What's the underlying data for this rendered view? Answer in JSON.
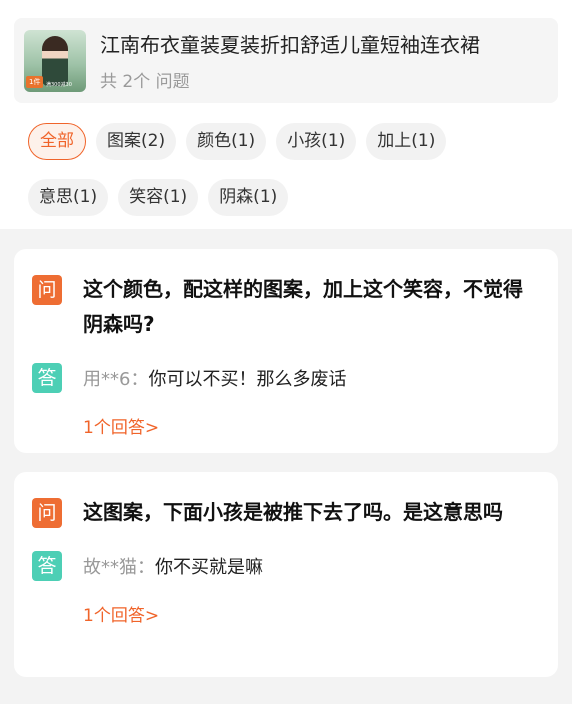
{
  "product": {
    "title": "江南布衣童装夏装折扣舒适儿童短袖连衣裙",
    "count": "共 2个 问题",
    "thumb_tag": "1件",
    "thumb_promo": "满300减30"
  },
  "filters": [
    {
      "label": "全部",
      "active": true
    },
    {
      "label": "图案(2)",
      "active": false
    },
    {
      "label": "颜色(1)",
      "active": false
    },
    {
      "label": "小孩(1)",
      "active": false
    },
    {
      "label": "加上(1)",
      "active": false
    },
    {
      "label": "意思(1)",
      "active": false
    },
    {
      "label": "笑容(1)",
      "active": false
    },
    {
      "label": "阴森(1)",
      "active": false
    }
  ],
  "questions": [
    {
      "q_badge": "问",
      "question": "这个颜色，配这样的图案，加上这个笑容，不觉得阴森吗?",
      "a_badge": "答",
      "user": "用**6：",
      "answer": "你可以不买！那么多废话",
      "more": "1个回答>"
    },
    {
      "q_badge": "问",
      "question": "这图案，下面小孩是被推下去了吗。是这意思吗",
      "a_badge": "答",
      "user": "故**猫：",
      "answer": "你不买就是嘛",
      "more": "1个回答>"
    }
  ],
  "colors": {
    "accent": "#f0642a",
    "question_badge": "#ee6d33",
    "answer_badge": "#4dcfb5"
  }
}
